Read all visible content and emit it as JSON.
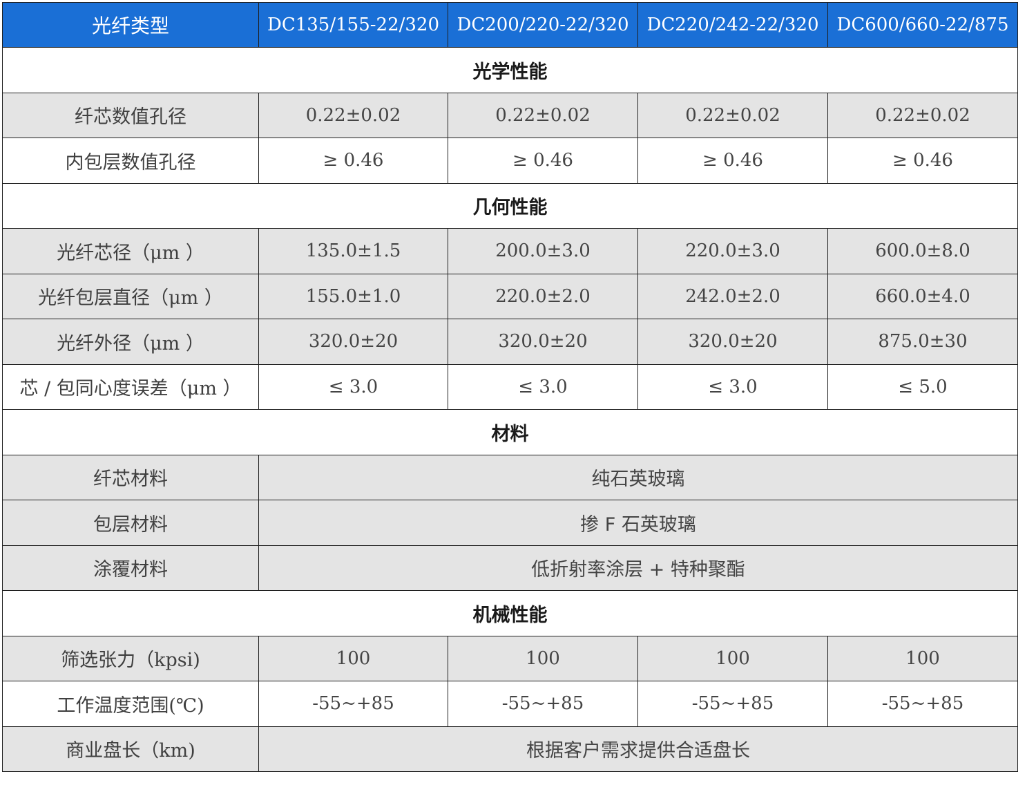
{
  "colors": {
    "header_bg": "#1a6fd6",
    "header_text": "#ffffff",
    "shaded_row": "#e4e4e4",
    "border": "#1f1f1f"
  },
  "header": {
    "first": "光纤类型",
    "models": [
      "DC135/155-22/320",
      "DC200/220-22/320",
      "DC220/242-22/320",
      "DC600/660-22/875"
    ]
  },
  "optical": {
    "title": "光学性能",
    "core_na": {
      "label": "纤芯数值孔径",
      "values": [
        "0.22±0.02",
        "0.22±0.02",
        "0.22±0.02",
        "0.22±0.02"
      ]
    },
    "inner_clad_na": {
      "label": "内包层数值孔径",
      "values": [
        "≥ 0.46",
        "≥ 0.46",
        "≥ 0.46",
        "≥ 0.46"
      ]
    }
  },
  "geometry": {
    "title": "几何性能",
    "core_diameter": {
      "label": "光纤芯径",
      "unit": "（μm ）",
      "values": [
        "135.0±1.5",
        "200.0±3.0",
        "220.0±3.0",
        "600.0±8.0"
      ]
    },
    "clad_diameter": {
      "label": "光纤包层直径",
      "unit": "（μm ）",
      "values": [
        "155.0±1.0",
        "220.0±2.0",
        "242.0±2.0",
        "660.0±4.0"
      ]
    },
    "outer_diameter": {
      "label": "光纤外径",
      "unit": "（μm ）",
      "values": [
        "320.0±20",
        "320.0±20",
        "320.0±20",
        "875.0±30"
      ]
    },
    "concentricity": {
      "label": "芯 / 包同心度误差",
      "unit": "（μm ）",
      "values": [
        "≤ 3.0",
        "≤ 3.0",
        "≤ 3.0",
        "≤ 5.0"
      ]
    }
  },
  "material": {
    "title": "材料",
    "core": {
      "label": "纤芯材料",
      "value": "纯石英玻璃"
    },
    "clad": {
      "label": "包层材料",
      "value": "掺 F 石英玻璃"
    },
    "coating": {
      "label": "涂覆材料",
      "value": "低折射率涂层 + 特种聚酯"
    }
  },
  "mechanical": {
    "title": "机械性能",
    "proof_test": {
      "label": "筛选张力",
      "unit": "（kpsi)",
      "values": [
        "100",
        "100",
        "100",
        "100"
      ]
    },
    "temp_range": {
      "label": "工作温度范围",
      "unit": "(℃)",
      "values": [
        "-55~+85",
        "-55~+85",
        "-55~+85",
        "-55~+85"
      ]
    },
    "length": {
      "label": "商业盘长",
      "unit": "（km)",
      "value": "根据客户需求提供合适盘长"
    }
  }
}
